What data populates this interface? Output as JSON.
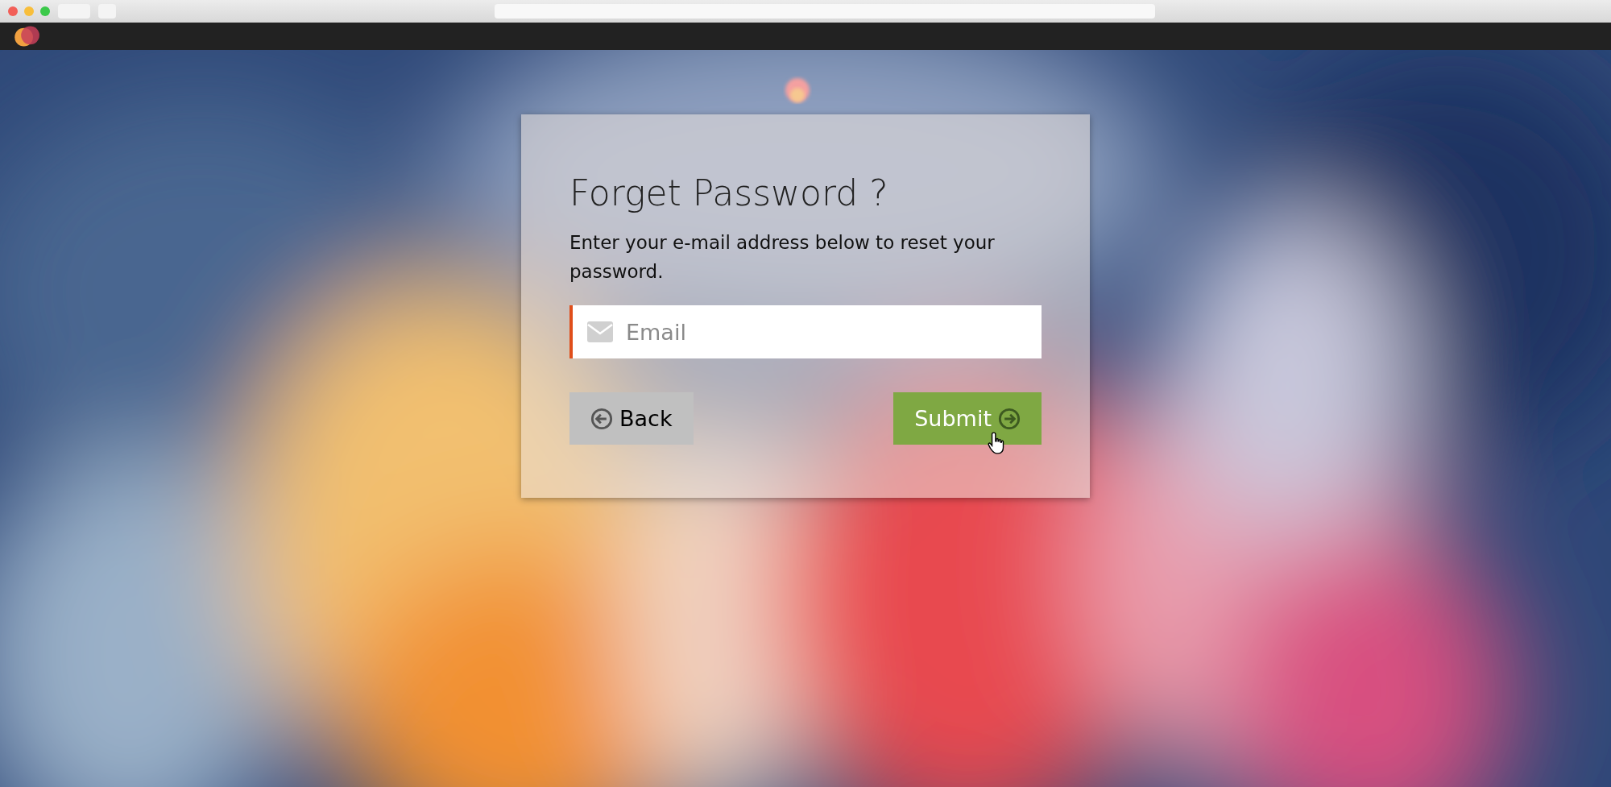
{
  "card": {
    "title": "Forget Password ?",
    "description": "Enter your e-mail address below to reset your password.",
    "email_field": {
      "placeholder": "Email"
    },
    "buttons": [
      {
        "kind": "back",
        "label": "Back"
      },
      {
        "kind": "submit",
        "label": "Submit"
      }
    ]
  }
}
